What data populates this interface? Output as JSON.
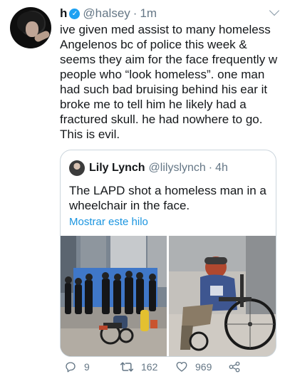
{
  "tweet": {
    "name": "h",
    "handle": "@halsey",
    "separator": "·",
    "time": "1m",
    "lines": [
      "ive given med assist to many homeless",
      "Angelenos bc of police this week &",
      "seems they aim for the face frequently w",
      "people who “look homeless”. one man",
      "had such bad bruising behind his ear it",
      "broke me to tell him he likely had a",
      "fractured skull. he had nowhere to go.",
      "This is evil."
    ]
  },
  "quoted": {
    "name": "Lily Lynch",
    "handle": "@lilyslynch",
    "separator": "·",
    "time": "4h",
    "lines": [
      "The LAPD shot a homeless man in a",
      "wheelchair in the face."
    ],
    "thread_link": "Mostrar este hilo"
  },
  "actions": {
    "reply_count": "9",
    "retweet_count": "162",
    "like_count": "969"
  },
  "colors": {
    "accent": "#1da1f2",
    "link": "#1b95e0",
    "muted": "#657786",
    "border": "#ccd6dd"
  },
  "icons": [
    "verified-badge-icon",
    "chevron-down-icon",
    "reply-icon",
    "retweet-icon",
    "like-icon",
    "share-icon"
  ]
}
